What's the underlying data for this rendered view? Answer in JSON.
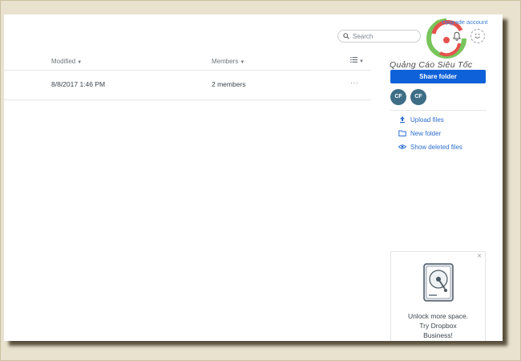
{
  "header": {
    "upgrade_label": "Upgrade account",
    "search_placeholder": "Search"
  },
  "watermark": {
    "text": "Quảng Cáo Siêu Tốc"
  },
  "table": {
    "columns": [
      {
        "label": "Modified"
      },
      {
        "label": "Members"
      }
    ],
    "rows": [
      {
        "modified": "8/8/2017 1:46 PM",
        "members": "2 members",
        "more": "···"
      }
    ]
  },
  "sidebar": {
    "share_label": "Share folder",
    "members": [
      "CF",
      "CF"
    ],
    "actions": [
      {
        "label": "Upload files",
        "icon": "upload-icon"
      },
      {
        "label": "New folder",
        "icon": "folder-icon"
      },
      {
        "label": "Show deleted files",
        "icon": "eye-icon"
      }
    ]
  },
  "promo": {
    "close": "×",
    "lines": [
      "Unlock more space.",
      "Try Dropbox",
      "Business!"
    ]
  },
  "colors": {
    "accent": "#0f61d9",
    "link": "#2f6fd0",
    "avatar": "#3d6e86",
    "background": "#e9e2cf"
  }
}
